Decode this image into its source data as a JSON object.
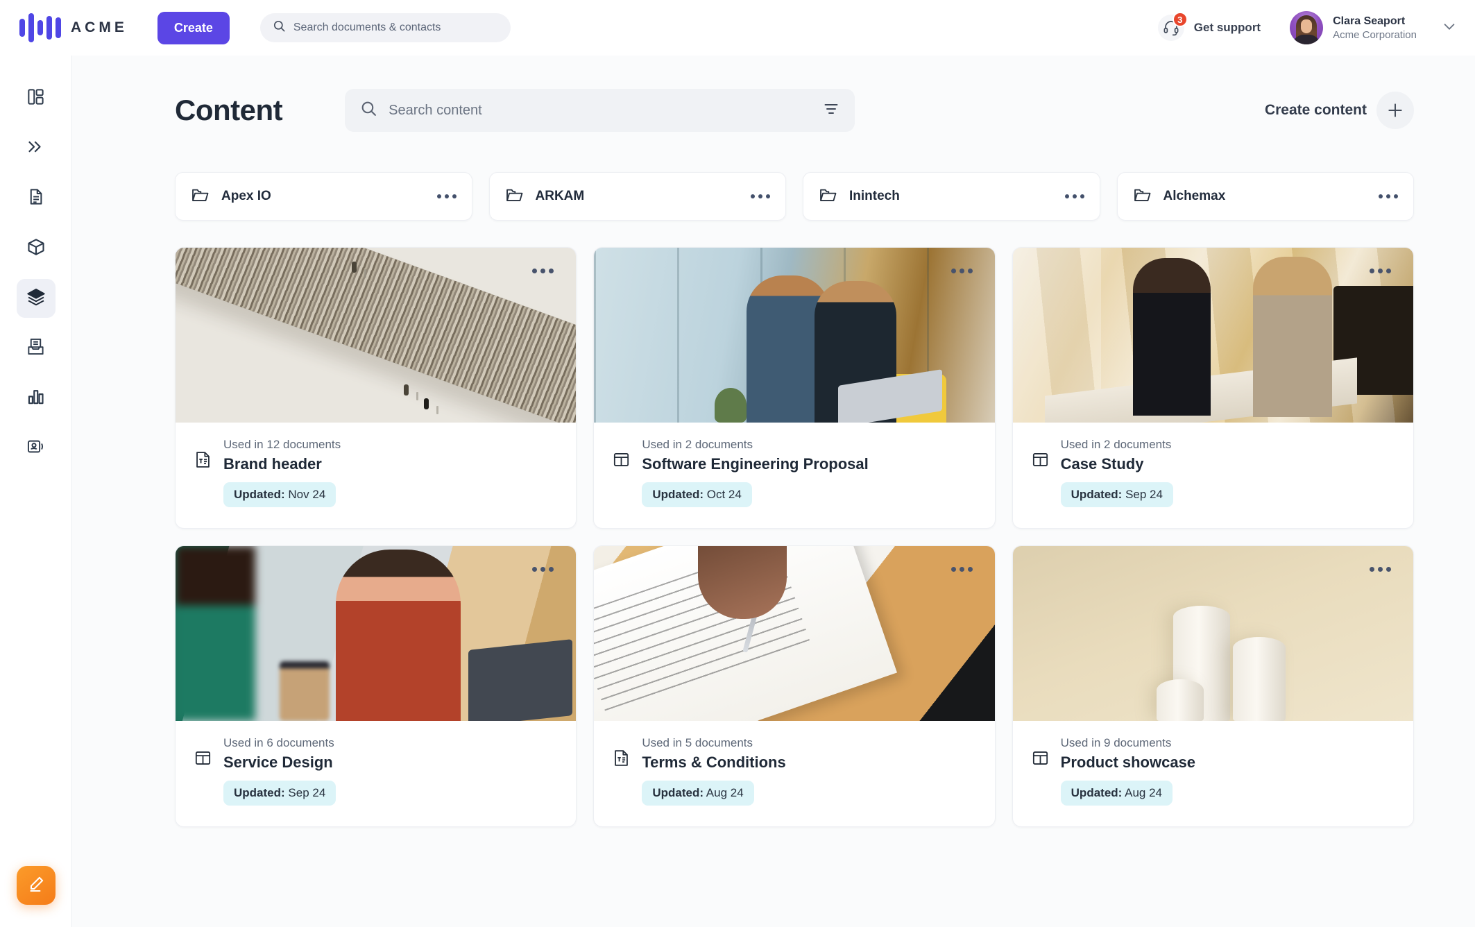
{
  "topbar": {
    "brand": "ACME",
    "create_label": "Create",
    "search_placeholder": "Search documents & contacts",
    "search_value": "",
    "support_label": "Get support",
    "support_badge": "3",
    "user_name": "Clara Seaport",
    "user_org": "Acme Corporation"
  },
  "sidebar": {
    "items": [
      {
        "name": "dashboard",
        "label": "Dashboard"
      },
      {
        "name": "chevrons",
        "label": "Workflows"
      },
      {
        "name": "document",
        "label": "Documents"
      },
      {
        "name": "cube",
        "label": "Products"
      },
      {
        "name": "layers",
        "label": "Content"
      },
      {
        "name": "inbox",
        "label": "Inbox"
      },
      {
        "name": "chart",
        "label": "Analytics"
      },
      {
        "name": "contacts",
        "label": "Contacts"
      }
    ],
    "active_index": 4,
    "fab_label": "Compose"
  },
  "page": {
    "title": "Content",
    "search_placeholder": "Search content",
    "search_value": "",
    "create_content_label": "Create content"
  },
  "folders": [
    {
      "name": "Apex IO"
    },
    {
      "name": "ARKAM"
    },
    {
      "name": "Inintech"
    },
    {
      "name": "Alchemax"
    }
  ],
  "cards": [
    {
      "used": "Used in 12 documents",
      "title": "Brand header",
      "updated_label": "Updated:",
      "updated_value": "Nov 24",
      "icon": "text-block-icon",
      "thumb": "crowd-aerial-photo"
    },
    {
      "used": "Used in 2 documents",
      "title": "Software Engineering Proposal",
      "updated_label": "Updated:",
      "updated_value": "Oct 24",
      "icon": "layout-columns-icon",
      "thumb": "two-men-laptop-office-photo"
    },
    {
      "used": "Used in 2 documents",
      "title": "Case Study",
      "updated_label": "Updated:",
      "updated_value": "Sep 24",
      "icon": "layout-columns-icon",
      "thumb": "two-women-stairs-photo"
    },
    {
      "used": "Used in 6 documents",
      "title": "Service Design",
      "updated_label": "Updated:",
      "updated_value": "Sep 24",
      "icon": "layout-columns-icon",
      "thumb": "smiling-woman-cafe-photo"
    },
    {
      "used": "Used in 5 documents",
      "title": "Terms & Conditions",
      "updated_label": "Updated:",
      "updated_value": "Aug 24",
      "icon": "text-block-icon",
      "thumb": "hand-signing-document-photo"
    },
    {
      "used": "Used in 9 documents",
      "title": "Product showcase",
      "updated_label": "Updated:",
      "updated_value": "Aug 24",
      "icon": "layout-columns-icon",
      "thumb": "beige-podium-cylinders-photo"
    }
  ],
  "colors": {
    "brand_indigo": "#4f46e5",
    "create_button": "#5b46e5",
    "badge_red": "#e8462c",
    "pill_cyan": "#dcf4f8",
    "fab_orange": "#f57c19",
    "canvas": "#fafbfc"
  }
}
